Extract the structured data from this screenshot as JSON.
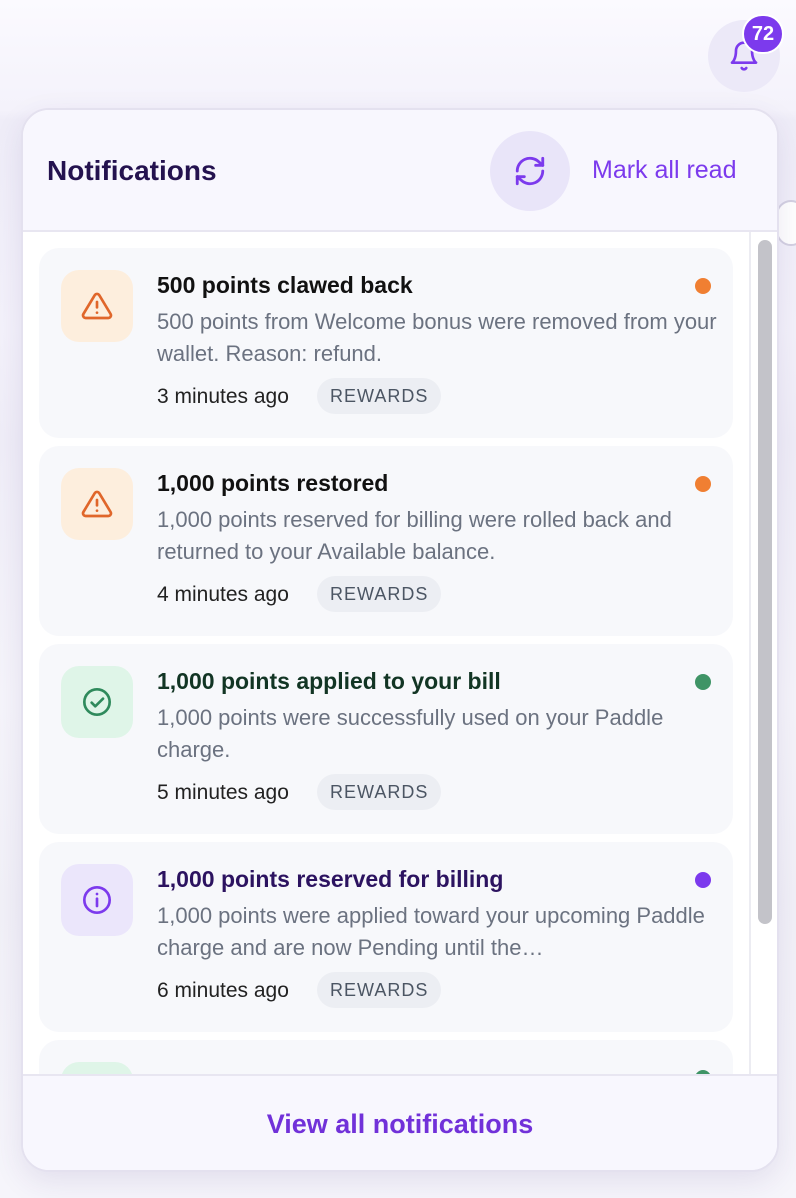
{
  "bell": {
    "badge_count": "72",
    "icon": "bell-icon"
  },
  "header": {
    "title": "Notifications",
    "refresh_icon": "refresh-icon",
    "mark_all_read": "Mark all read"
  },
  "notifications": [
    {
      "title": "500 points clawed back",
      "body": "500 points from Welcome bonus were removed from your wallet. Reason: refund.",
      "time": "3 minutes ago",
      "tag": "REWARDS",
      "icon": "warning-icon",
      "icon_bg": "#fdeedd",
      "icon_color": "#e0662a",
      "title_color": "#111111",
      "dot_color": "#f07f32"
    },
    {
      "title": "1,000 points restored",
      "body": "1,000 points reserved for billing were rolled back and returned to your Available balance.",
      "time": "4 minutes ago",
      "tag": "REWARDS",
      "icon": "warning-icon",
      "icon_bg": "#fdeedd",
      "icon_color": "#e0662a",
      "title_color": "#111111",
      "dot_color": "#f07f32"
    },
    {
      "title": "1,000 points applied to your bill",
      "body": "1,000 points were successfully used on your Paddle charge.",
      "time": "5 minutes ago",
      "tag": "REWARDS",
      "icon": "check-circle-icon",
      "icon_bg": "#dff5e8",
      "icon_color": "#2f8a5c",
      "title_color": "#123524",
      "dot_color": "#3f9466"
    },
    {
      "title": "1,000 points reserved for billing",
      "body": "1,000 points were applied toward your upcoming Paddle charge and are now Pending until the…",
      "time": "6 minutes ago",
      "tag": "REWARDS",
      "icon": "info-icon",
      "icon_bg": "#ebe6fb",
      "icon_color": "#7c3aed",
      "title_color": "#2c1360",
      "dot_color": "#7c3aed"
    }
  ],
  "footer": {
    "view_all": "View all notifications"
  }
}
